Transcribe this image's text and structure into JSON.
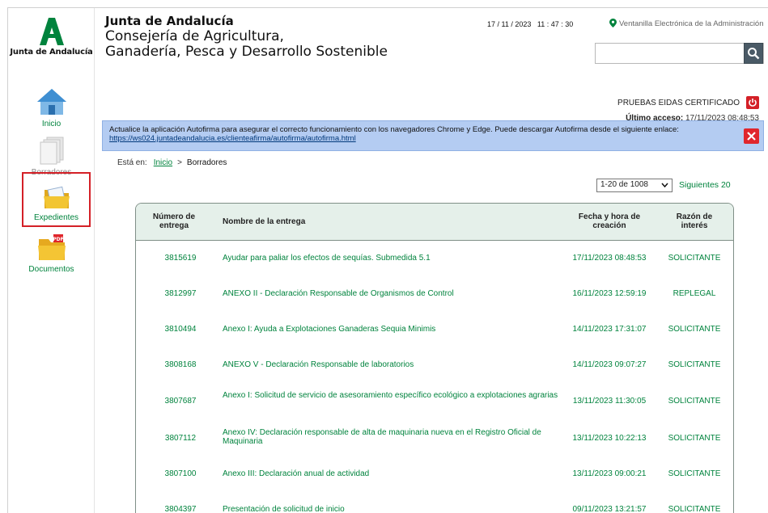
{
  "sidebar": {
    "brand": "Junta de Andalucía",
    "items": [
      {
        "label": "Inicio",
        "icon": "home-icon"
      },
      {
        "label": "Borradores",
        "icon": "drafts-icon"
      },
      {
        "label": "Expedientes",
        "icon": "folder-icon"
      },
      {
        "label": "Documentos",
        "icon": "pdf-folder-icon"
      }
    ]
  },
  "header": {
    "junta": "Junta de Andalucía",
    "consejeria_line1": "Consejería de Agricultura,",
    "consejeria_line2": "Ganadería, Pesca y Desarrollo Sostenible",
    "datetime": "17 / 11 / 2023   11 : 47 : 30",
    "ventanilla": "Ventanilla Electrónica de la Administración",
    "search_placeholder": ""
  },
  "user": {
    "name": "PRUEBAS EIDAS CERTIFICADO",
    "last_access_label": "Último acceso:",
    "last_access_value": "17/11/2023 08:48:53"
  },
  "alert": {
    "text": "Actualice la aplicación Autofirma para asegurar el correcto funcionamiento con los navegadores Chrome y Edge. Puede descargar Autofirma desde el siguiente enlace:",
    "link": "https://ws024.juntadeandalucia.es/clienteafirma/autofirma/autofirma.html"
  },
  "breadcrumb": {
    "prefix": "Está en:",
    "home": "Inicio",
    "separator": ">",
    "current": "Borradores"
  },
  "pager": {
    "selected": "1-20 de 1008",
    "next": "Siguientes 20"
  },
  "table": {
    "headers": {
      "numero_l1": "Número de",
      "numero_l2": "entrega",
      "nombre": "Nombre de la entrega",
      "fecha_l1": "Fecha y hora de",
      "fecha_l2": "creación",
      "razon_l1": "Razón de",
      "razon_l2": "interés"
    },
    "rows": [
      {
        "numero": "3815619",
        "nombre": "Ayudar para paliar los efectos de sequías. Submedida 5.1",
        "fecha": "17/11/2023 08:48:53",
        "razon": "SOLICITANTE"
      },
      {
        "numero": "3812997",
        "nombre": "ANEXO II - Declaración Responsable de Organismos de Control",
        "fecha": "16/11/2023 12:59:19",
        "razon": "REPLEGAL"
      },
      {
        "numero": "3810494",
        "nombre": "Anexo I: Ayuda a Explotaciones Ganaderas Sequia Minimis",
        "fecha": "14/11/2023 17:31:07",
        "razon": "SOLICITANTE"
      },
      {
        "numero": "3808168",
        "nombre": "ANEXO V - Declaración Responsable de laboratorios",
        "fecha": "14/11/2023 09:07:27",
        "razon": "SOLICITANTE"
      },
      {
        "numero": "3807687",
        "nombre": "Anexo I: Solicitud de servicio de asesoramiento específico ecológico a explotaciones agrarias",
        "fecha": "13/11/2023 11:30:05",
        "razon": "SOLICITANTE"
      },
      {
        "numero": "3807112",
        "nombre": "Anexo IV: Declaración responsable de alta de maquinaria nueva en el Registro Oficial de Maquinaria",
        "fecha": "13/11/2023 10:22:13",
        "razon": "SOLICITANTE"
      },
      {
        "numero": "3807100",
        "nombre": "Anexo III: Declaración anual de actividad",
        "fecha": "13/11/2023 09:00:21",
        "razon": "SOLICITANTE"
      },
      {
        "numero": "3804397",
        "nombre": "Presentación de solicitud de inicio",
        "fecha": "09/11/2023 13:21:57",
        "razon": "SOLICITANTE"
      }
    ]
  }
}
